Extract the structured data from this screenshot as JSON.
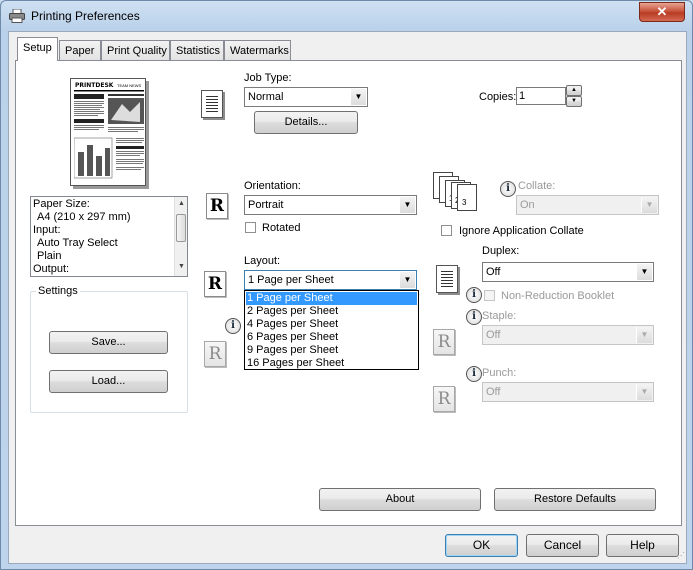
{
  "window": {
    "title": "Printing Preferences",
    "close_label": "✕"
  },
  "tabs": [
    {
      "label": "Setup",
      "active": true
    },
    {
      "label": "Paper"
    },
    {
      "label": "Print Quality"
    },
    {
      "label": "Statistics"
    },
    {
      "label": "Watermarks"
    }
  ],
  "info_list": [
    "Paper Size:",
    "A4 (210 x 297 mm)",
    "Input:",
    "Auto Tray Select",
    "Plain",
    "Output:"
  ],
  "settings": {
    "title": "Settings",
    "save": "Save...",
    "load": "Load..."
  },
  "job_type": {
    "label": "Job Type:",
    "value": "Normal",
    "details": "Details..."
  },
  "copies": {
    "label": "Copies:",
    "value": "1"
  },
  "orientation": {
    "label": "Orientation:",
    "value": "Portrait",
    "rotated": "Rotated",
    "icon_letter": "R"
  },
  "collate": {
    "label": "Collate:",
    "value": "On",
    "ignore": "Ignore Application Collate",
    "pages": [
      "1",
      "2",
      "3"
    ]
  },
  "layout": {
    "label": "Layout:",
    "value": "1 Page per Sheet",
    "icon_letter": "R",
    "options": [
      "1 Page per Sheet",
      "2 Pages per Sheet",
      "4 Pages per Sheet",
      "6 Pages per Sheet",
      "9 Pages per Sheet",
      "16 Pages per Sheet"
    ],
    "selected_index": 0
  },
  "duplex": {
    "label": "Duplex:",
    "value": "Off",
    "non_reduction": "Non-Reduction Booklet"
  },
  "staple": {
    "label": "Staple:",
    "value": "Off",
    "icon_letter": "R"
  },
  "punch": {
    "label": "Punch:",
    "value": "Off",
    "icon_letter": "R"
  },
  "disabled_r_letter": "R",
  "info_icon_letter": "i",
  "about": "About",
  "restore": "Restore Defaults",
  "footer": {
    "ok": "OK",
    "cancel": "Cancel",
    "help": "Help"
  },
  "preview": {
    "masthead": "PRINTDESK",
    "tagline": "TEAM NEWS"
  }
}
